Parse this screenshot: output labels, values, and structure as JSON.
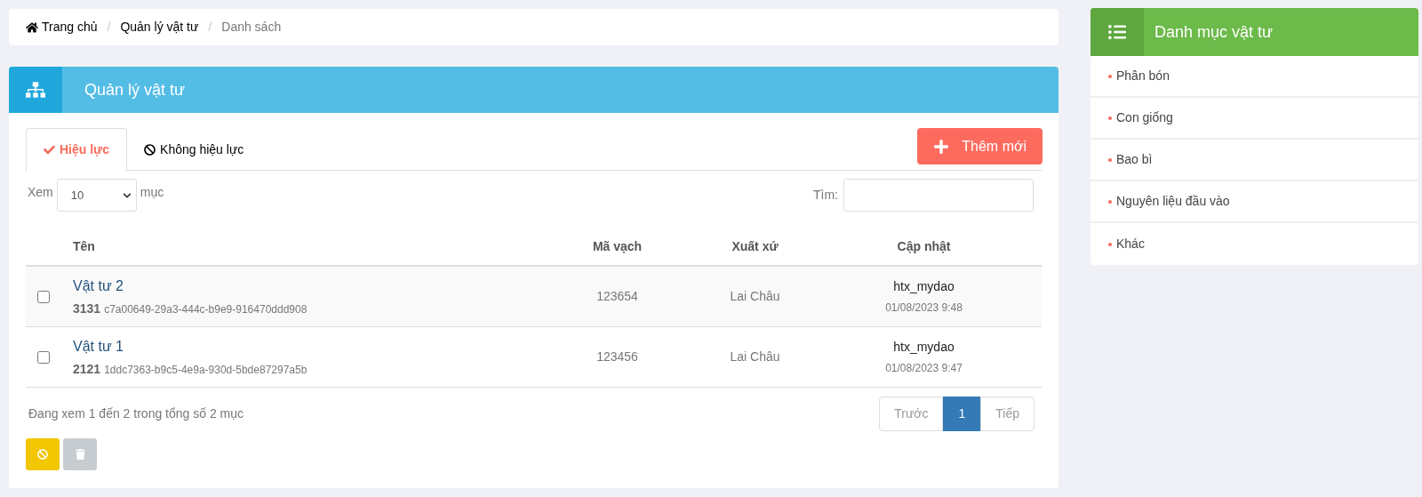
{
  "breadcrumb": [
    {
      "label": "Trang chủ",
      "kind": "home"
    },
    {
      "label": "Quản lý vật tư",
      "kind": "link"
    },
    {
      "label": "Danh sách",
      "kind": "current"
    }
  ],
  "breadcrumb_separator": "/",
  "panel": {
    "title": "Quản lý vật tư"
  },
  "tabs": [
    {
      "label": "Hiệu lực",
      "kind": "check",
      "selected": true
    },
    {
      "label": "Không hiệu lực",
      "kind": "ban",
      "selected": false
    }
  ],
  "add_button": "Thêm mới",
  "length": {
    "before": "Xem",
    "value": "10",
    "after": "mục"
  },
  "search": {
    "label": "Tìm:"
  },
  "table": {
    "columns": [
      "Tên",
      "Mã vạch",
      "Xuất xứ",
      "Cập nhật"
    ],
    "rows": [
      {
        "checked": false,
        "name": "Vật tư 2",
        "code": "3131",
        "guid": "c7a00649-29a3-444c-b9e9-916470ddd908",
        "barcode": "123654",
        "origin": "Lai Châu",
        "user": "htx_mydao",
        "time": "01/08/2023 9:48"
      },
      {
        "checked": false,
        "name": "Vật tư 1",
        "code": "2121",
        "guid": "1ddc7363-b9c5-4e9a-930d-5bde87297a5b",
        "barcode": "123456",
        "origin": "Lai Châu",
        "user": "htx_mydao",
        "time": "01/08/2023 9:47"
      }
    ]
  },
  "info": "Đang xem 1 đến 2 trong tổng số 2 mục",
  "pagination": [
    {
      "label": "Trước",
      "selected": false
    },
    {
      "label": "1",
      "selected": true
    },
    {
      "label": "Tiếp",
      "selected": false
    }
  ],
  "actions": [
    {
      "kind": "ban",
      "disabled": false
    },
    {
      "kind": "trash",
      "disabled": true
    }
  ],
  "categories": {
    "title": "Danh mục vật tư",
    "items": [
      "Phân bón",
      "Con giống",
      "Bao bì",
      "Nguyên liệu đầu vào",
      "Khác"
    ]
  }
}
